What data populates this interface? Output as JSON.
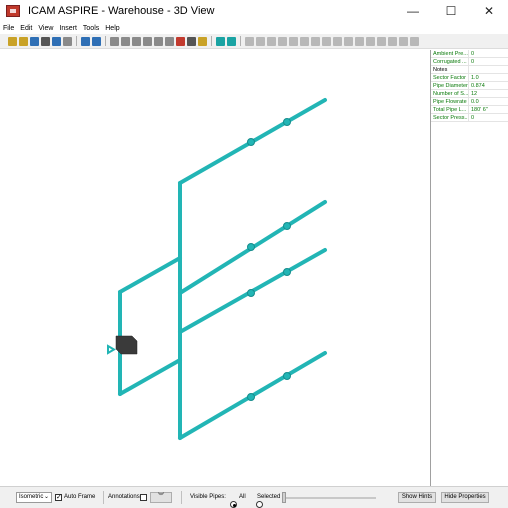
{
  "window": {
    "title": "ICAM ASPIRE - Warehouse - 3D View",
    "controls": {
      "minimize": "—",
      "maximize": "☐",
      "close": "✕"
    }
  },
  "menu": [
    "File",
    "Edit",
    "View",
    "Insert",
    "Tools",
    "Help"
  ],
  "properties": [
    {
      "name": "Ambient Pre...",
      "value": "0"
    },
    {
      "name": "Corrugated ...",
      "value": "0"
    },
    {
      "name": "Notes",
      "value": ""
    },
    {
      "name": "Sector Factor",
      "value": "1.0"
    },
    {
      "name": "Pipe Diameter",
      "value": "0.874"
    },
    {
      "name": "Number of S...",
      "value": "12"
    },
    {
      "name": "Pipe Flowrate",
      "value": "0.0"
    },
    {
      "name": "Total Pipe L...",
      "value": "180' 6\""
    },
    {
      "name": "Sector Press...",
      "value": "0"
    }
  ],
  "bottom": {
    "view_select": "Isometric",
    "auto_frame_label": "Auto Frame",
    "auto_frame_checked": true,
    "annotations_label": "Annotations",
    "annotations_checked": false,
    "expand_glyph": "︾",
    "visible_pipes_label": "Visible Pipes:",
    "radio_all": "All",
    "radio_selected": "Selected",
    "show_hints": "Show Hints",
    "hide_properties": "Hide Properties"
  },
  "colors": {
    "pipe": "#22b5b5",
    "pipe_dark": "#158c8c",
    "source": "#3a3a3a"
  }
}
